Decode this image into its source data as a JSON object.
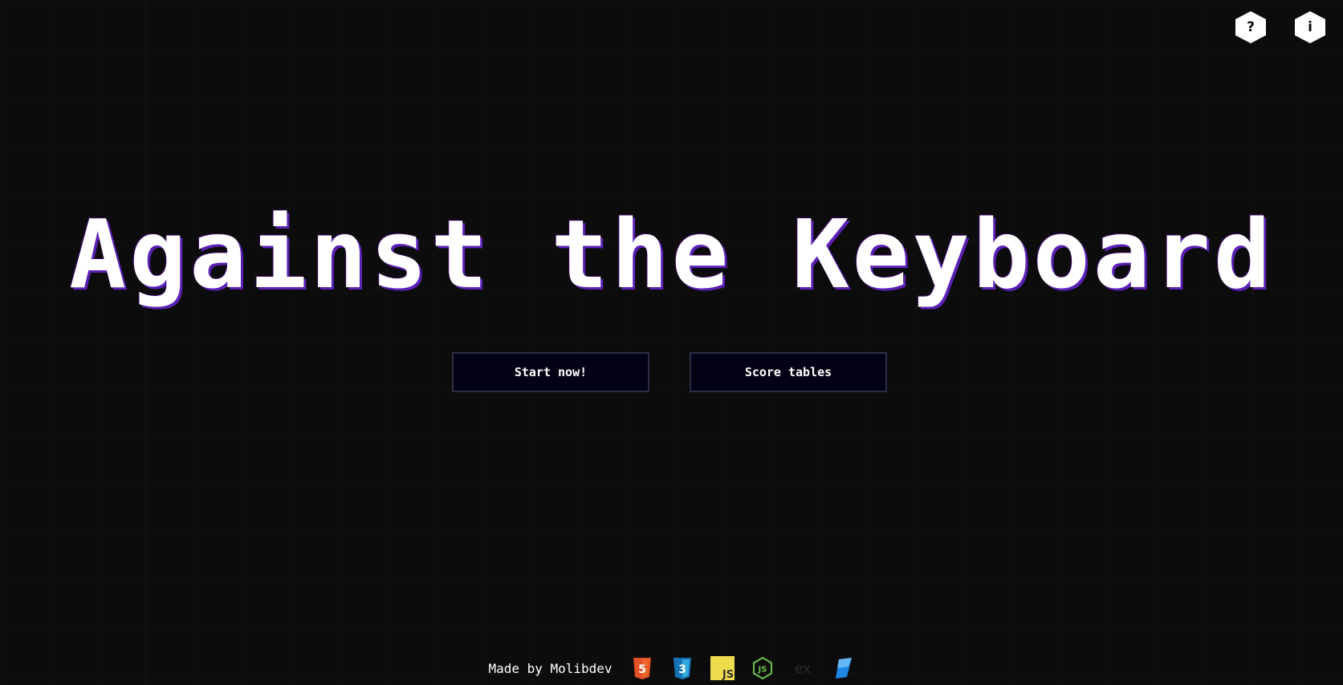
{
  "header": {
    "help_icon": "question-mark",
    "help_glyph": "?",
    "info_icon": "info",
    "info_glyph": "i"
  },
  "main": {
    "title": "Against the Keyboard",
    "start_label": "Start now!",
    "scores_label": "Score tables"
  },
  "footer": {
    "made_by": "Made by Molibdev",
    "tech_icons": [
      "html5-icon",
      "css3-icon",
      "javascript-icon",
      "nodejs-icon",
      "express-icon",
      "sequelize-icon"
    ],
    "express_glyph": "ex",
    "js_glyph": "JS"
  },
  "colors": {
    "background": "#0c0c0c",
    "text": "#ffffff",
    "title_shadow": "#5b21b6",
    "button_bg": "#020214",
    "button_border": "#2c2c48",
    "html5": "#e34f26",
    "css3": "#1572b6",
    "javascript": "#f0db4f",
    "nodejs": "#6cc24a"
  }
}
